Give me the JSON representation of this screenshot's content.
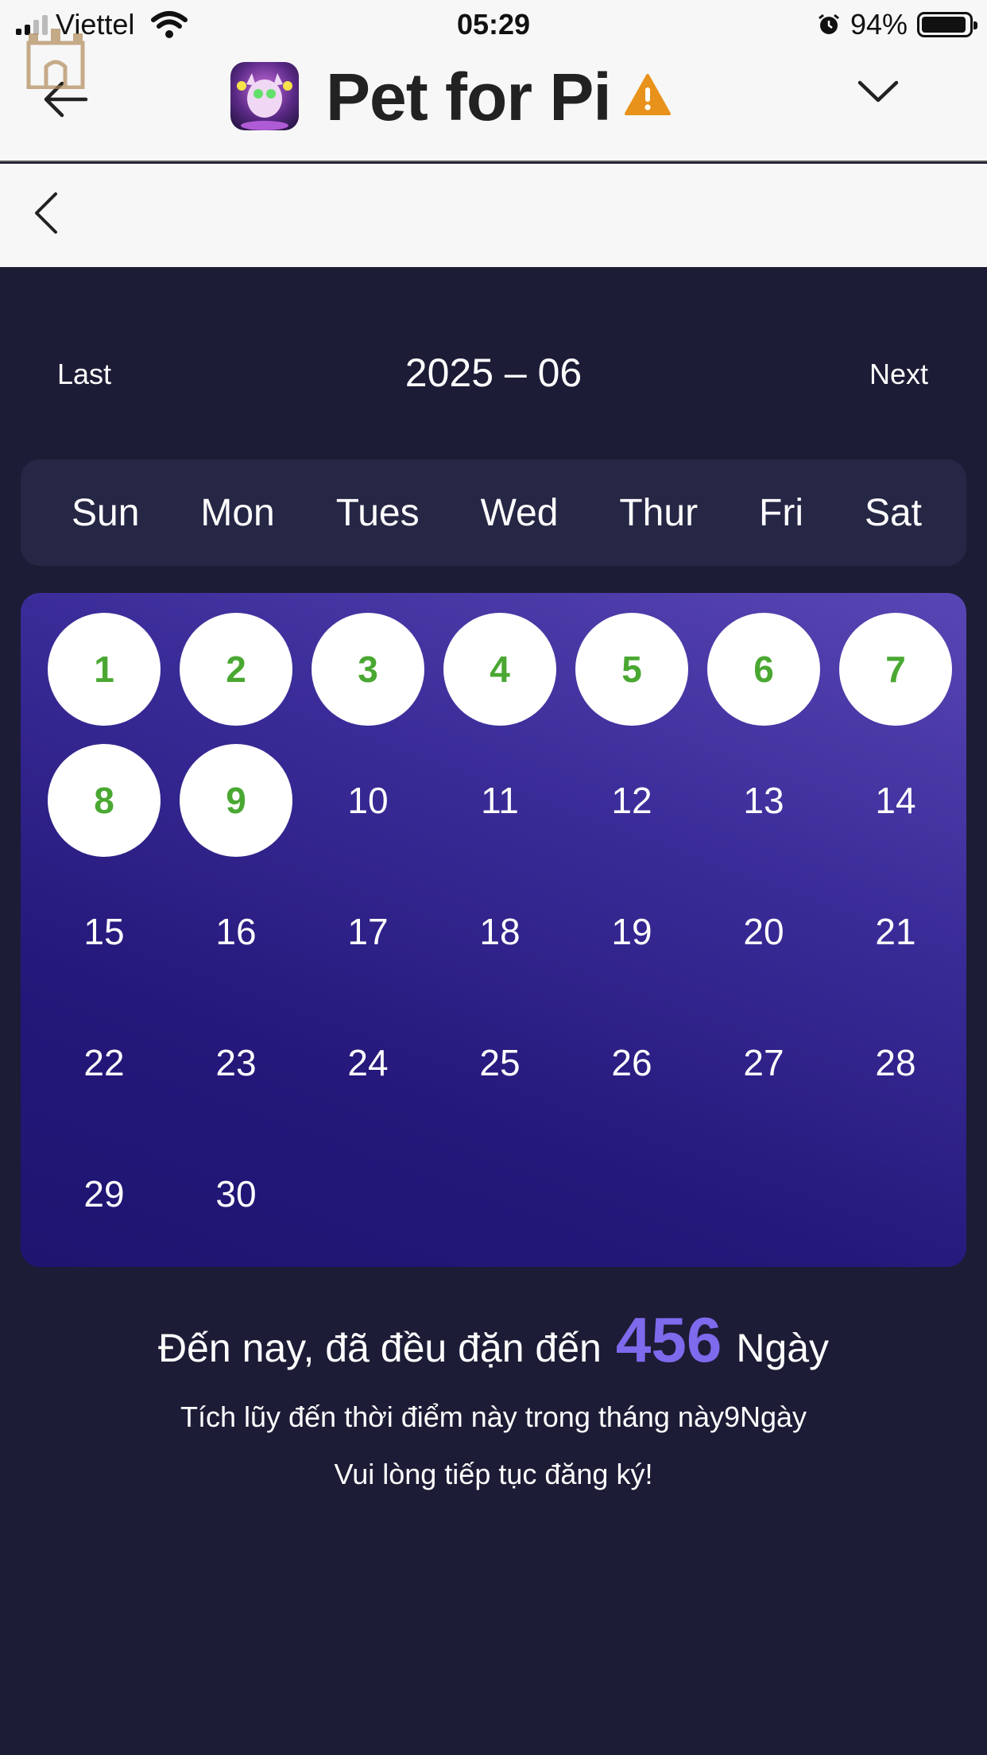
{
  "status_bar": {
    "carrier": "Viettel",
    "time": "05:29",
    "battery": "94%"
  },
  "header": {
    "title": "Pet for Pi",
    "icons": {
      "back": "arrow-left-icon",
      "overlay": "castle-icon",
      "warning": "warning-icon",
      "dropdown": "chevron-down-icon"
    },
    "colors": {
      "warning": "#e8921c"
    }
  },
  "calendar": {
    "nav": {
      "last": "Last",
      "month": "2025 – 06",
      "next": "Next"
    },
    "weekdays": [
      "Sun",
      "Mon",
      "Tues",
      "Wed",
      "Thur",
      "Fri",
      "Sat"
    ],
    "weeks": [
      [
        "1",
        "2",
        "3",
        "4",
        "5",
        "6",
        "7"
      ],
      [
        "8",
        "9",
        "10",
        "11",
        "12",
        "13",
        "14"
      ],
      [
        "15",
        "16",
        "17",
        "18",
        "19",
        "20",
        "21"
      ],
      [
        "22",
        "23",
        "24",
        "25",
        "26",
        "27",
        "28"
      ],
      [
        "29",
        "30",
        "",
        "",
        "",
        "",
        ""
      ]
    ],
    "checked_days": [
      "1",
      "2",
      "3",
      "4",
      "5",
      "6",
      "7",
      "8",
      "9"
    ],
    "colors": {
      "checked_text": "#4aa832",
      "checked_bg": "#ffffff"
    }
  },
  "summary": {
    "prefix": "Đến nay, đã đều đặn đến",
    "count": "456",
    "suffix": "Ngày",
    "line2": "Tích lũy đến thời điểm này trong tháng này9Ngày",
    "line3": "Vui lòng tiếp tục đăng ký!"
  }
}
